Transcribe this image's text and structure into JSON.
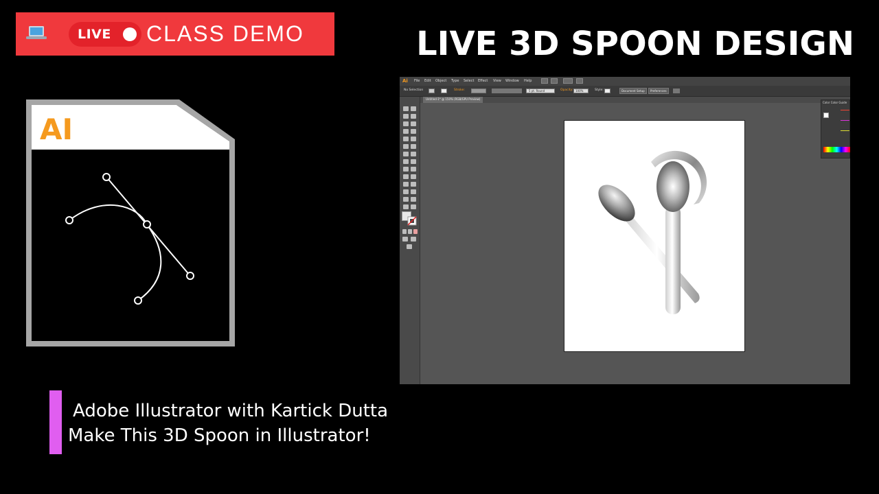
{
  "banner": {
    "icon": "laptop-icon",
    "live_label": "LIVE",
    "class_demo": "CLASS DEMO",
    "colors": {
      "banner_bg": "#f0393d",
      "pill_bg": "#e3222a"
    }
  },
  "headline": "LIVE 3D SPOON DESIGN",
  "file_icon": {
    "label": "AI",
    "icon": "illustrator-file-icon",
    "label_color": "#f59a1f"
  },
  "screenshot": {
    "app_badge": "Ai",
    "menu": [
      "File",
      "Edit",
      "Object",
      "Type",
      "Select",
      "Effect",
      "View",
      "Window",
      "Help"
    ],
    "control_bar": {
      "selection": "No Selection",
      "stroke_label": "Stroke:",
      "brush": "5 pt. Round",
      "opacity_label": "Opacity:",
      "opacity_value": "100%",
      "style_label": "Style:",
      "document_setup": "Document Setup",
      "preferences": "Preferences"
    },
    "doc_tab": "Untitled-1* @ 150% (RGB/GPU Preview)",
    "panel_tabs": "Color  Color Guide"
  },
  "caption": {
    "line1": "Adobe Illustrator with Kartick Dutta",
    "line2": "Make This 3D Spoon in Illustrator!",
    "accent_color": "#e05ef0"
  }
}
